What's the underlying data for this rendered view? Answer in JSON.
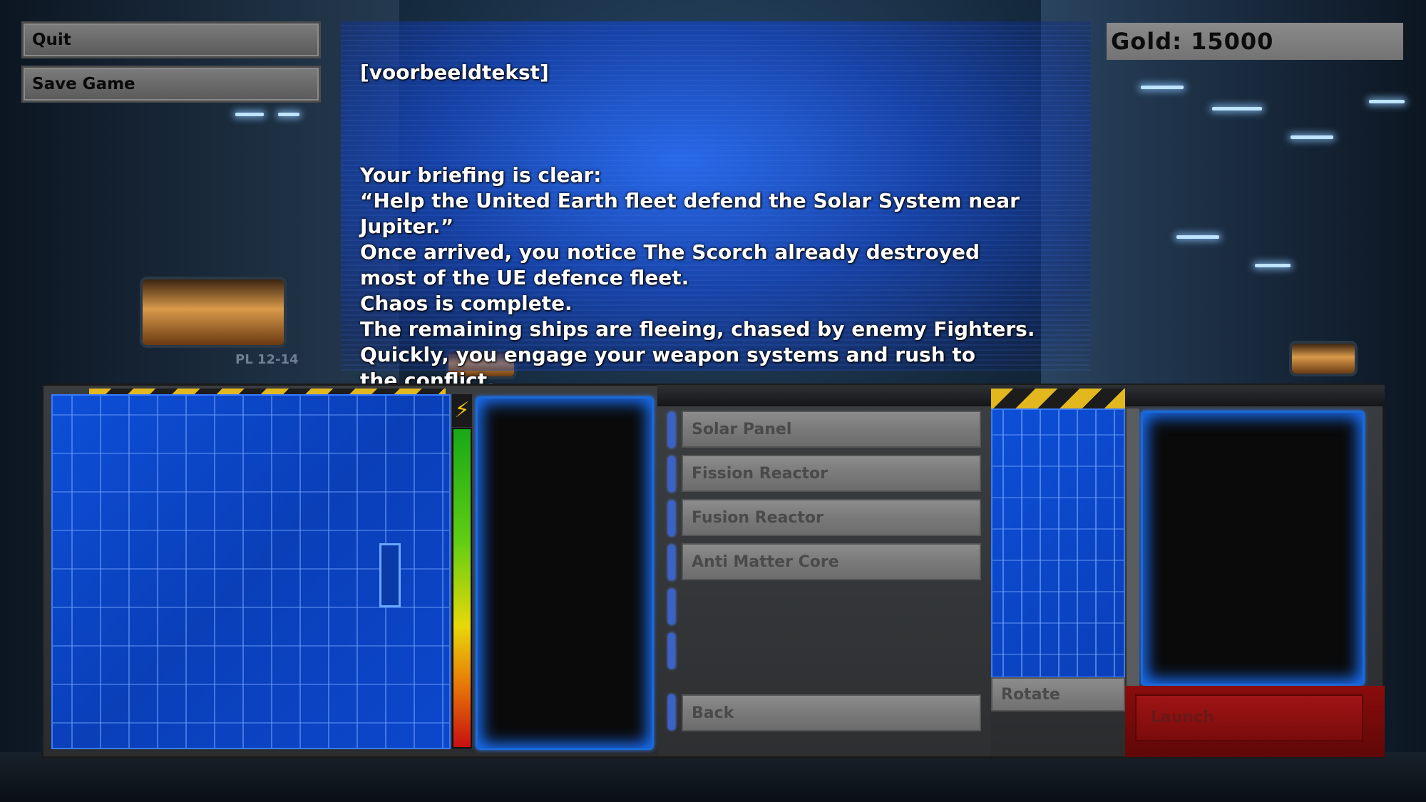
{
  "menu": {
    "quit_label": "Quit",
    "save_label": "Save Game"
  },
  "gold": {
    "label": "Gold: 15000"
  },
  "briefing": {
    "header": "[voorbeeldtekst]",
    "body": "Your briefing is clear:\n“Help the United Earth fleet defend the Solar System near\nJupiter.”\nOnce arrived, you notice The Scorch already destroyed\nmost of the UE defence fleet.\nChaos is complete.\nThe remaining ships are fleeing, chased by enemy Fighters.\nQuickly, you engage your weapon systems and rush to\nthe conflict."
  },
  "background": {
    "wall_sign": "PL 12-14"
  },
  "components": {
    "items": [
      {
        "label": "Solar Panel"
      },
      {
        "label": "Fission Reactor"
      },
      {
        "label": "Fusion Reactor"
      },
      {
        "label": "Anti Matter Core"
      }
    ],
    "back_label": "Back"
  },
  "controls": {
    "rotate_label": "Rotate",
    "launch_label": "Launch"
  },
  "colors": {
    "accent_blue": "#1a6ad8",
    "hazard_yellow": "#e3b81f",
    "launch_red": "#8a0c0c"
  }
}
